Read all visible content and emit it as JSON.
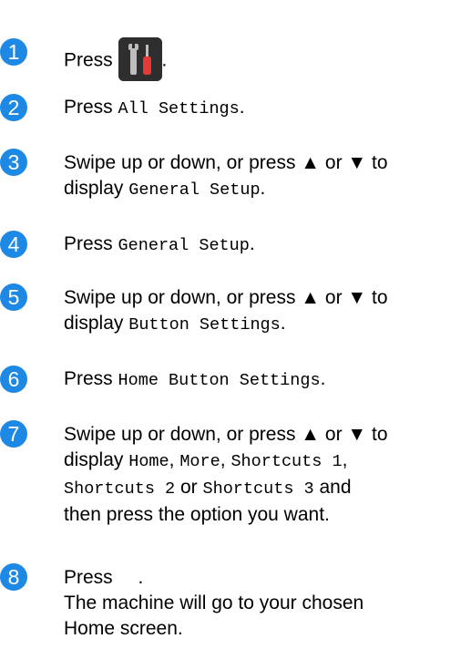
{
  "colors": {
    "step_number_bg": "#1e88e5",
    "icon_bg": "#2e2e2e",
    "icon_screwdriver": "#e53935",
    "icon_wrench": "#bdbdbd"
  },
  "icons": {
    "settings": "settings-tools-icon"
  },
  "steps": [
    {
      "number": "1",
      "press": "Press",
      "period": "."
    },
    {
      "number": "2",
      "press": "Press",
      "option": "All Settings",
      "period": "."
    },
    {
      "number": "3",
      "line1": "Swipe up or down, or press ▲ or ▼ to",
      "display": "display",
      "option": "General Setup",
      "period": "."
    },
    {
      "number": "4",
      "press": "Press",
      "option": "General Setup",
      "period": "."
    },
    {
      "number": "5",
      "line1": "Swipe up or down, or press ▲ or ▼ to",
      "display": "display",
      "option": "Button Settings",
      "period": "."
    },
    {
      "number": "6",
      "press": "Press",
      "option": "Home Button Settings",
      "period": "."
    },
    {
      "number": "7",
      "line1": "Swipe up or down, or press ▲ or ▼ to",
      "display": "display",
      "opt_home": "Home",
      "comma": ",",
      "opt_more": "More",
      "opt_sc1": "Shortcuts 1",
      "opt_sc2": "Shortcuts 2",
      "or": "or",
      "opt_sc3": "Shortcuts 3",
      "and": "and",
      "line4": "then press the option you want."
    },
    {
      "number": "8",
      "press": "Press",
      "period": ".",
      "note_line1": "The machine will go to your chosen",
      "note_line2": "Home screen."
    }
  ]
}
